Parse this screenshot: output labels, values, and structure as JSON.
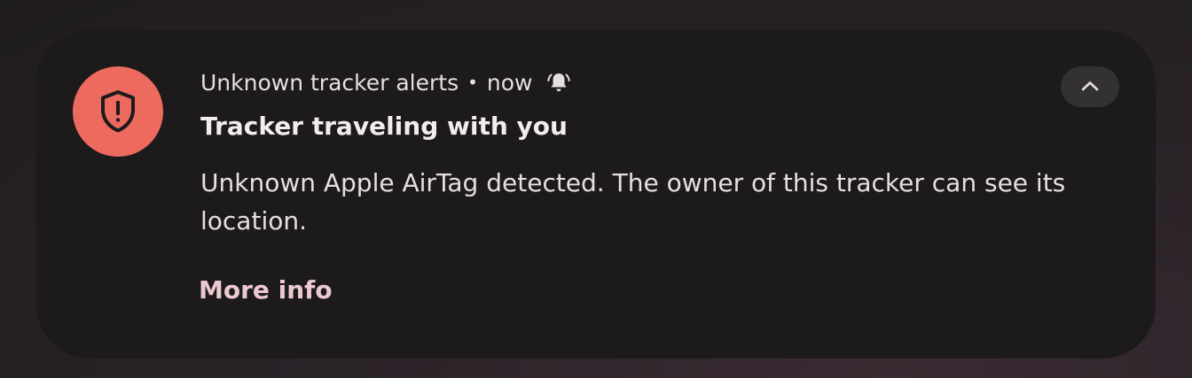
{
  "notification": {
    "app_name": "Unknown tracker alerts",
    "separator": "•",
    "time": "now",
    "title": "Tracker traveling with you",
    "body": "Unknown Apple AirTag detected. The owner of this tracker can see its location.",
    "action_label": "More info",
    "icons": {
      "app": "shield-alert-icon",
      "alerting": "bell-ringing-icon",
      "collapse": "chevron-up-icon"
    },
    "colors": {
      "app_icon_bg": "#ec6a5e",
      "action_text": "#ecc9d0",
      "card_bg": "#1c1a1b"
    }
  }
}
